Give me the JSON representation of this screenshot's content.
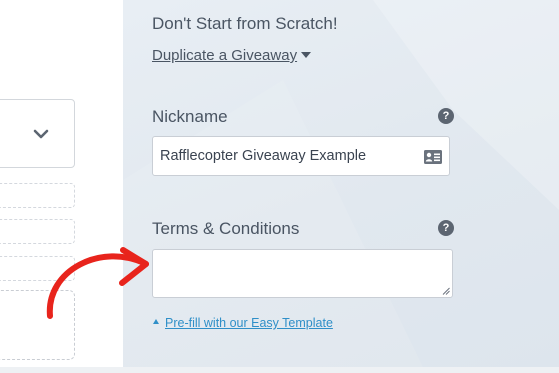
{
  "duplicate_section": {
    "heading": "Don't Start from Scratch!",
    "link_label": "Duplicate a Giveaway"
  },
  "nickname": {
    "label": "Nickname",
    "help": "?",
    "value": "Rafflecopter Giveaway Example",
    "icon": "contact-card-icon"
  },
  "terms": {
    "label": "Terms & Conditions",
    "help": "?",
    "value": "",
    "prefill_label": "Pre-fill with our Easy Template"
  },
  "annotation": {
    "arrow_color": "#e8241c"
  },
  "colors": {
    "panel_bg": "#e3e9f0",
    "text": "#4a5563",
    "link": "#2f8fc8",
    "help_icon": "#5c6571"
  }
}
